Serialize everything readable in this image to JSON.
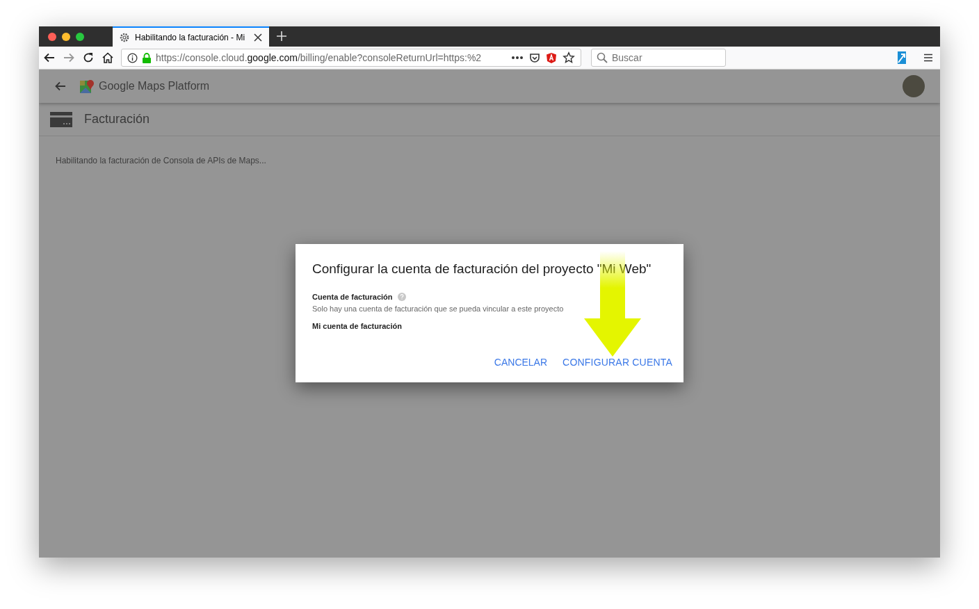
{
  "browser": {
    "tabs": [
      {
        "title": "Habilitando la facturación - Mi",
        "selected": true
      }
    ],
    "url": [
      {
        "text": "https://console.cloud.",
        "highlight": false
      },
      {
        "text": "google.com",
        "highlight": true
      },
      {
        "text": "/billing/enable?consoleReturnUrl=https:%2",
        "highlight": false
      }
    ],
    "search": {
      "placeholder": "Buscar"
    }
  },
  "app_bar": {
    "title": "Google Maps Platform"
  },
  "section": {
    "title": "Facturación"
  },
  "status_text": "Habilitando la facturación de Consola de APIs de Maps...",
  "dialog": {
    "title": "Configurar la cuenta de facturación del proyecto \"Mi Web\"",
    "field_label": "Cuenta de facturación",
    "hint": "Solo hay una cuenta de facturación que se pueda vincular a este proyecto",
    "value": "Mi cuenta de facturación",
    "buttons": [
      {
        "label": "CANCELAR",
        "kind": "secondary"
      },
      {
        "label": "CONFIGURAR CUENTA",
        "kind": "primary"
      }
    ]
  }
}
